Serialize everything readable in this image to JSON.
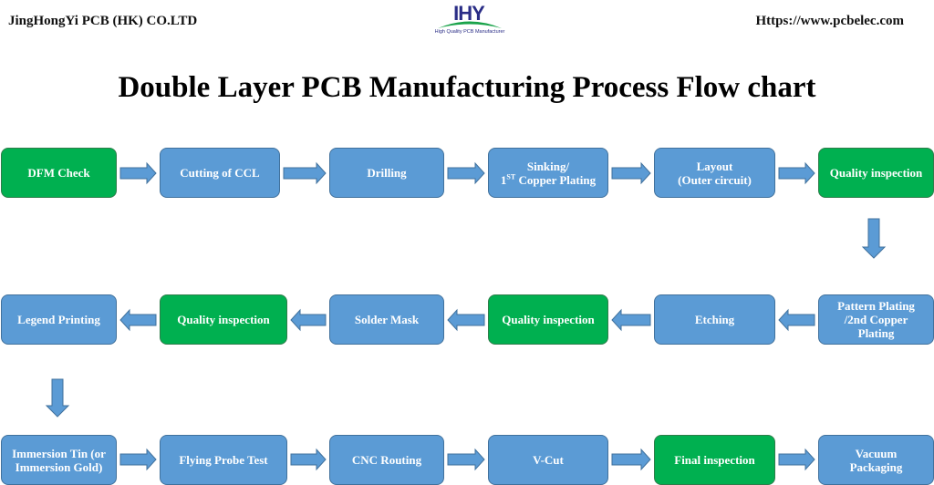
{
  "header": {
    "company": "JingHongYi PCB (HK) CO.LTD",
    "website": "Https://www.pcbelec.com",
    "logo": {
      "mark": "IHY",
      "tagline": "High Quality PCB Manufacturer"
    }
  },
  "title": "Double Layer PCB Manufacturing Process Flow chart",
  "colors": {
    "process_step": "#5b9bd5",
    "inspection_step": "#00b050",
    "arrow": "#5b9bd5"
  },
  "steps": [
    {
      "id": 1,
      "label": "DFM Check",
      "type": "inspection",
      "row": 1
    },
    {
      "id": 2,
      "label": "Cutting of CCL",
      "type": "process",
      "row": 1
    },
    {
      "id": 3,
      "label": "Drilling",
      "type": "process",
      "row": 1
    },
    {
      "id": 4,
      "label_line1": "Sinking/",
      "label_line2_prefix": "1",
      "label_line2_sup": "ST",
      "label_line2_suffix": " Copper Plating",
      "type": "process",
      "row": 1
    },
    {
      "id": 5,
      "label_line1": "Layout",
      "label_line2": "(Outer circuit)",
      "type": "process",
      "row": 1
    },
    {
      "id": 6,
      "label": "Quality inspection",
      "type": "inspection",
      "row": 1
    },
    {
      "id": 7,
      "label_line1": "Pattern Plating",
      "label_line2": "/2nd Copper",
      "label_line3": "Plating",
      "type": "process",
      "row": 2
    },
    {
      "id": 8,
      "label": "Etching",
      "type": "process",
      "row": 2
    },
    {
      "id": 9,
      "label": "Quality inspection",
      "type": "inspection",
      "row": 2
    },
    {
      "id": 10,
      "label": "Solder Mask",
      "type": "process",
      "row": 2
    },
    {
      "id": 11,
      "label": "Quality inspection",
      "type": "inspection",
      "row": 2
    },
    {
      "id": 12,
      "label": "Legend Printing",
      "type": "process",
      "row": 2
    },
    {
      "id": 13,
      "label_line1": "Immersion Tin (or",
      "label_line2": "Immersion Gold)",
      "type": "process",
      "row": 3
    },
    {
      "id": 14,
      "label": "Flying Probe Test",
      "type": "process",
      "row": 3
    },
    {
      "id": 15,
      "label": "CNC Routing",
      "type": "process",
      "row": 3
    },
    {
      "id": 16,
      "label": "V-Cut",
      "type": "process",
      "row": 3
    },
    {
      "id": 17,
      "label": "Final inspection",
      "type": "inspection",
      "row": 3
    },
    {
      "id": 18,
      "label_line1": "Vacuum",
      "label_line2": "Packaging",
      "type": "process",
      "row": 3
    }
  ],
  "flow": [
    {
      "from": 1,
      "to": 2,
      "direction": "right"
    },
    {
      "from": 2,
      "to": 3,
      "direction": "right"
    },
    {
      "from": 3,
      "to": 4,
      "direction": "right"
    },
    {
      "from": 4,
      "to": 5,
      "direction": "right"
    },
    {
      "from": 5,
      "to": 6,
      "direction": "right"
    },
    {
      "from": 6,
      "to": 7,
      "direction": "down"
    },
    {
      "from": 7,
      "to": 8,
      "direction": "left"
    },
    {
      "from": 8,
      "to": 9,
      "direction": "left"
    },
    {
      "from": 9,
      "to": 10,
      "direction": "left"
    },
    {
      "from": 10,
      "to": 11,
      "direction": "left"
    },
    {
      "from": 11,
      "to": 12,
      "direction": "left"
    },
    {
      "from": 12,
      "to": 13,
      "direction": "down"
    },
    {
      "from": 13,
      "to": 14,
      "direction": "right"
    },
    {
      "from": 14,
      "to": 15,
      "direction": "right"
    },
    {
      "from": 15,
      "to": 16,
      "direction": "right"
    },
    {
      "from": 16,
      "to": 17,
      "direction": "right"
    },
    {
      "from": 17,
      "to": 18,
      "direction": "right"
    }
  ]
}
